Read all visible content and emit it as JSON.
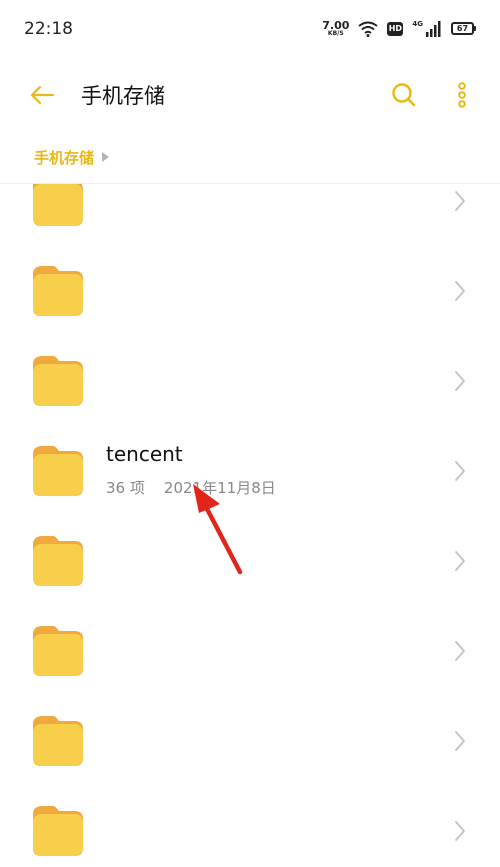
{
  "status_bar": {
    "time": "22:18",
    "net_speed_value": "7.00",
    "net_speed_unit": "KB/S",
    "hd_label": "HD",
    "network_label": "4G",
    "battery": "67",
    "icons": [
      "wifi-icon",
      "hd-icon",
      "signal-icon",
      "battery-icon"
    ]
  },
  "app_bar": {
    "back_icon": "back-arrow-icon",
    "title": "手机存储",
    "search_icon": "search-icon",
    "more_icon": "more-vertical-icon"
  },
  "breadcrumb": {
    "items": [
      "手机存储"
    ]
  },
  "files": [
    {
      "name": "",
      "meta": ""
    },
    {
      "name": "",
      "meta": ""
    },
    {
      "name": "",
      "meta": ""
    },
    {
      "name": "tencent",
      "meta": "36 项    2021年11月8日"
    },
    {
      "name": "",
      "meta": ""
    },
    {
      "name": "",
      "meta": ""
    },
    {
      "name": "",
      "meta": ""
    },
    {
      "name": "",
      "meta": ""
    }
  ],
  "colors": {
    "accent": "#e8b818",
    "folder": "#f7cf4a",
    "folder_tab": "#f0a93e",
    "annotation": "#e3241b"
  }
}
